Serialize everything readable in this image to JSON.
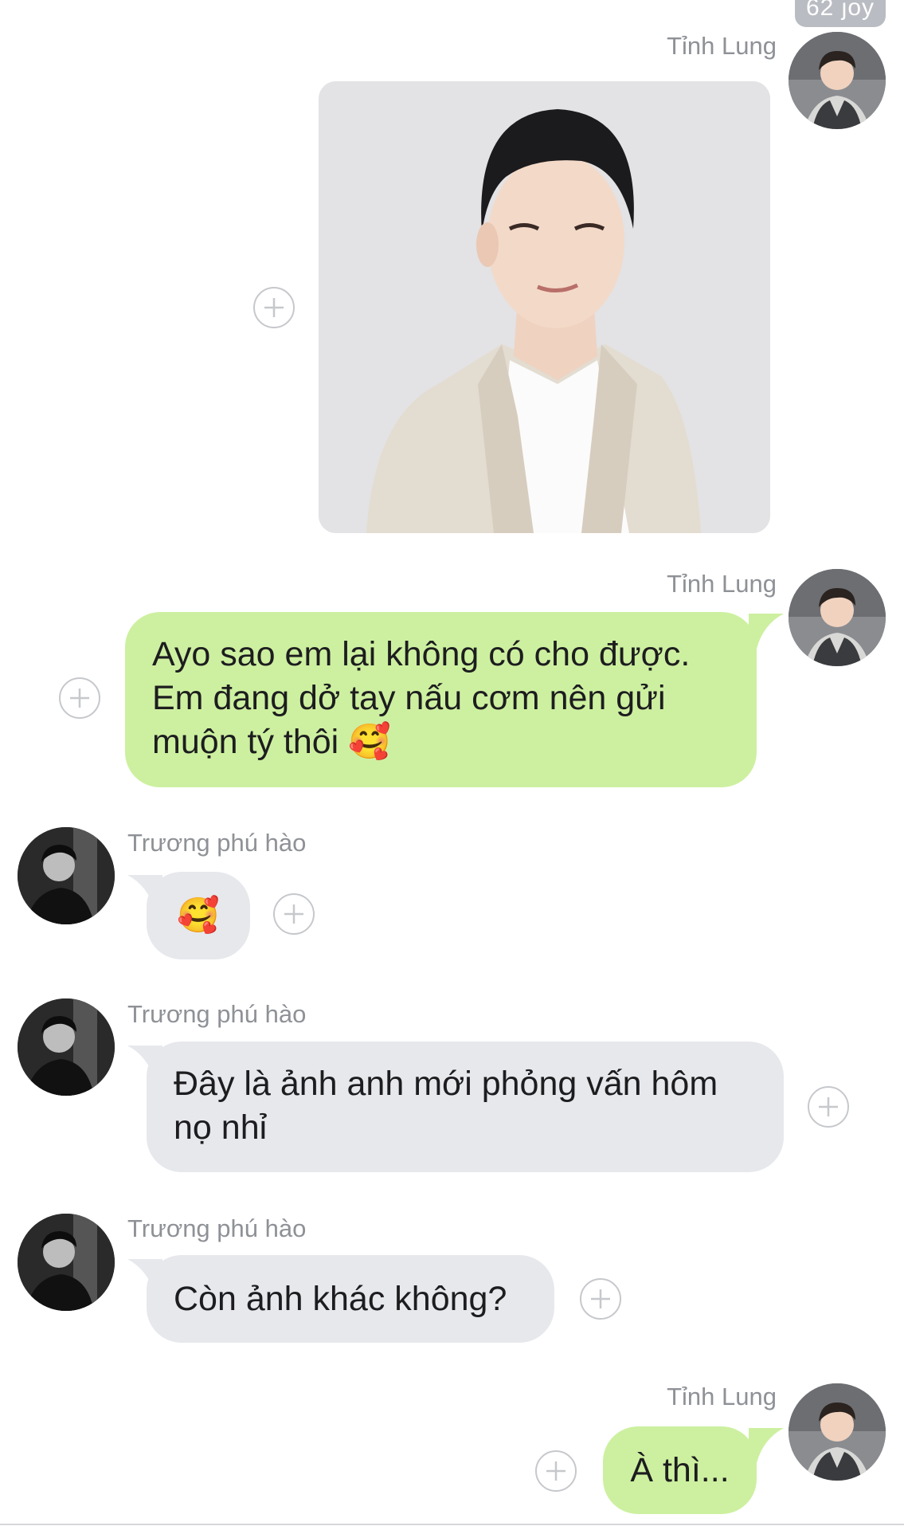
{
  "chat": {
    "top_badge": "62 joy",
    "messages": [
      {
        "sender": "Tỉnh Lung",
        "type": "image"
      },
      {
        "sender": "Tỉnh Lung",
        "type": "text",
        "text": "Ayo sao em lại không có cho được. Em đang dở tay nấu cơm nên gửi muộn tý thôi 🥰"
      },
      {
        "sender": "Trương phú hào",
        "type": "text",
        "text": "🥰"
      },
      {
        "sender": "Trương phú hào",
        "type": "text",
        "text": "Đây là ảnh anh mới phỏng vấn hôm nọ nhỉ"
      },
      {
        "sender": "Trương phú hào",
        "type": "text",
        "text": "Còn ảnh khác không?"
      },
      {
        "sender": "Tỉnh Lung",
        "type": "text",
        "text": "À thì..."
      }
    ]
  },
  "icons": {
    "avatar_me": "avatar-photo",
    "avatar_other": "avatar-photo",
    "reaction": "add-reaction-icon"
  },
  "colors": {
    "sent_bubble": "#cdf0a0",
    "received_bubble": "#e6e8ec",
    "name_text": "#8e9196",
    "badge_bg": "#b9bcc2"
  }
}
